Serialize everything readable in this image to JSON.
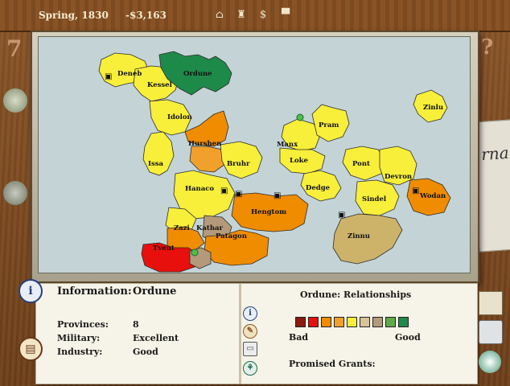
{
  "topbar": {
    "season": "Spring, 1830",
    "money": "-$3,163",
    "icons": [
      "building-icon",
      "factory-icon",
      "dollar-icon",
      "top-hat-icon"
    ]
  },
  "map": {
    "labels": [
      {
        "id": "deneb",
        "text": "Deneb"
      },
      {
        "id": "kessel",
        "text": "Kessel"
      },
      {
        "id": "ordune",
        "text": "Ordune"
      },
      {
        "id": "idolon",
        "text": "Idolon"
      },
      {
        "id": "zinlu",
        "text": "Zinlu"
      },
      {
        "id": "pram",
        "text": "Pram"
      },
      {
        "id": "hurshen",
        "text": "Hurshen"
      },
      {
        "id": "manx",
        "text": "Manx"
      },
      {
        "id": "loke",
        "text": "Loke"
      },
      {
        "id": "issa",
        "text": "Issa"
      },
      {
        "id": "bruhr",
        "text": "Bruhr"
      },
      {
        "id": "pont",
        "text": "Pont"
      },
      {
        "id": "devron",
        "text": "Devron"
      },
      {
        "id": "hanaco",
        "text": "Hanaco"
      },
      {
        "id": "dedge",
        "text": "Dedge"
      },
      {
        "id": "sindel",
        "text": "Sindel"
      },
      {
        "id": "wodan",
        "text": "Wodan"
      },
      {
        "id": "hengtom",
        "text": "Hengtom"
      },
      {
        "id": "zazi",
        "text": "Zazi"
      },
      {
        "id": "kathar",
        "text": "Kathar"
      },
      {
        "id": "zinnu",
        "text": "Zinnu"
      },
      {
        "id": "patagon",
        "text": "Patagon"
      },
      {
        "id": "tvent",
        "text": "Tvent"
      }
    ],
    "colors": {
      "sea": "#c4d4d6",
      "yellow": "#f8ef3a",
      "orange": "#f08c00",
      "light_orange": "#f2a02c",
      "red": "#e8100c",
      "green": "#1e8a4a",
      "tan": "#cdb36a",
      "grey_brown": "#b49a7a"
    }
  },
  "info": {
    "title_label": "Information:",
    "title_value": "Ordune",
    "provinces_label": "Provinces:",
    "provinces_value": "8",
    "military_label": "Military:",
    "military_value": "Excellent",
    "industry_label": "Industry:",
    "industry_value": "Good"
  },
  "relationships": {
    "title": "Ordune: Relationships",
    "scale": [
      "#8b1a10",
      "#e8100c",
      "#f08c00",
      "#f2a02c",
      "#f8ef3a",
      "#d7c39a",
      "#b49a7a",
      "#5fa94a",
      "#1e8a4a"
    ],
    "bad_label": "Bad",
    "good_label": "Good",
    "grants_label": "Promised Grants:"
  }
}
